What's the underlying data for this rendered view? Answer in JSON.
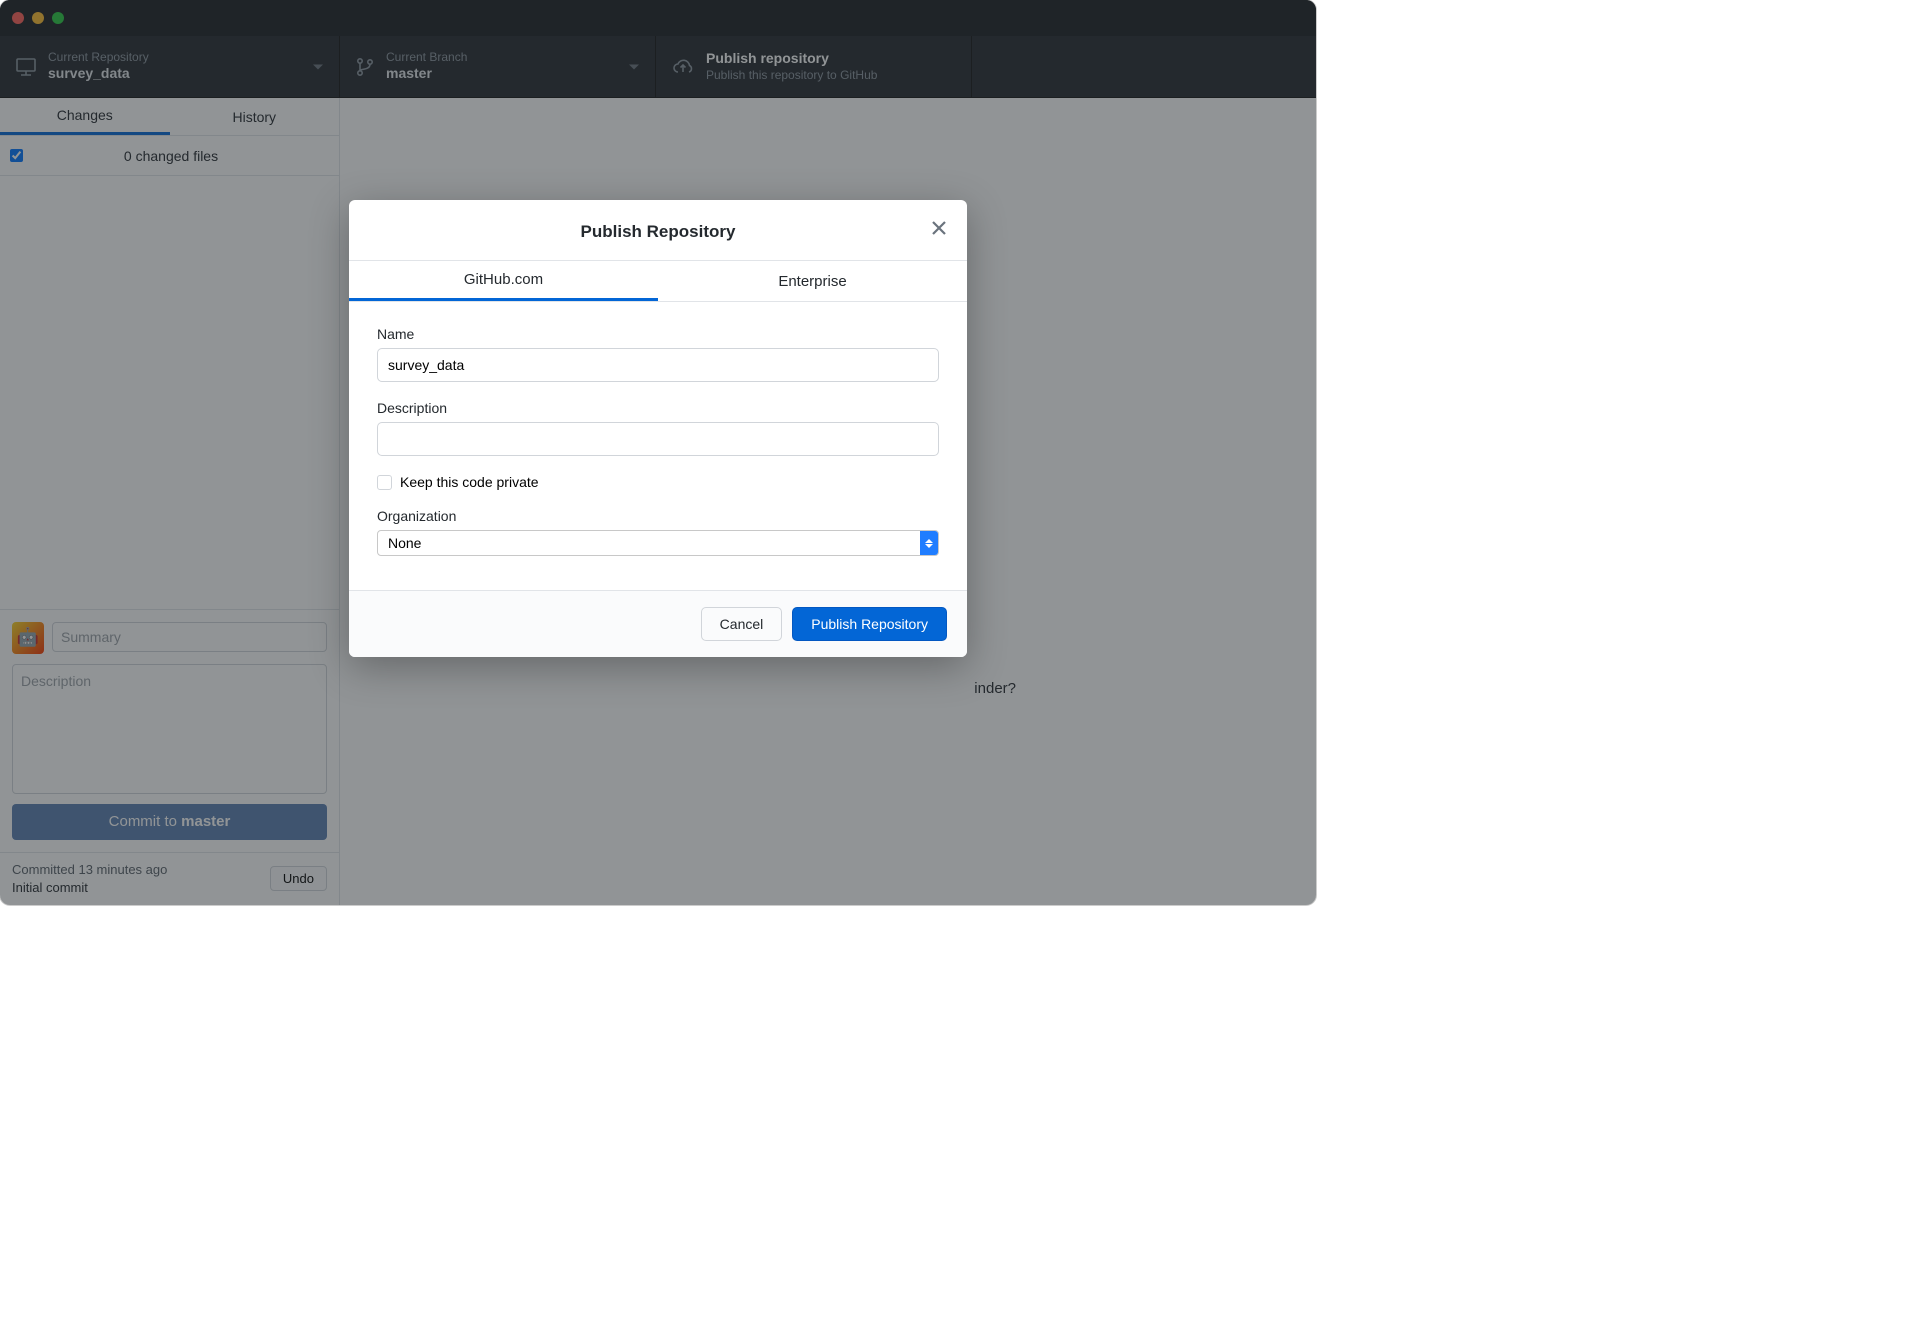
{
  "toolbar": {
    "repo": {
      "label": "Current Repository",
      "value": "survey_data"
    },
    "branch": {
      "label": "Current Branch",
      "value": "master"
    },
    "publish": {
      "label": "Publish repository",
      "value": "Publish this repository to GitHub"
    }
  },
  "sidebar": {
    "tabs": {
      "changes": "Changes",
      "history": "History"
    },
    "changes_header": "0 changed files",
    "commit": {
      "summary_placeholder": "Summary",
      "description_placeholder": "Description",
      "button_prefix": "Commit to ",
      "button_branch": "master"
    },
    "recent": {
      "meta": "Committed 13 minutes ago",
      "title": "Initial commit",
      "undo": "Undo"
    }
  },
  "content": {
    "hint_suffix": "inder?"
  },
  "modal": {
    "title": "Publish Repository",
    "tabs": {
      "github": "GitHub.com",
      "enterprise": "Enterprise"
    },
    "fields": {
      "name_label": "Name",
      "name_value": "survey_data",
      "description_label": "Description",
      "description_value": "",
      "private_label": "Keep this code private",
      "org_label": "Organization",
      "org_value": "None"
    },
    "buttons": {
      "cancel": "Cancel",
      "publish": "Publish Repository"
    }
  }
}
